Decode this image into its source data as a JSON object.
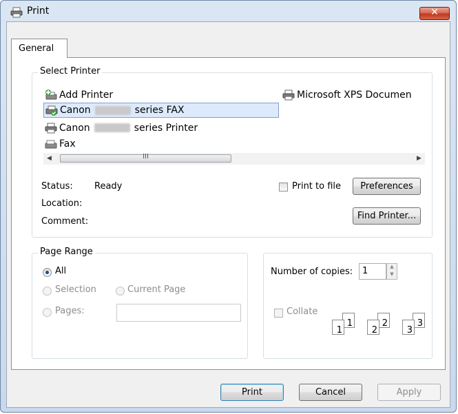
{
  "window": {
    "title": "Print"
  },
  "tabs": [
    {
      "label": "General"
    }
  ],
  "select_printer": {
    "group_label": "Select Printer",
    "printers": [
      {
        "name": "Add Printer",
        "icon": "add-printer-icon"
      },
      {
        "name_prefix": "Canon",
        "name_suffix": "series FAX",
        "icon": "fax-printer-icon",
        "selected": true
      },
      {
        "name_prefix": "Canon",
        "name_suffix": "series Printer",
        "icon": "printer-icon"
      },
      {
        "name": "Fax",
        "icon": "fax-icon"
      },
      {
        "name": "Microsoft XPS Documen",
        "icon": "printer-icon"
      }
    ],
    "status_label": "Status:",
    "status_value": "Ready",
    "location_label": "Location:",
    "comment_label": "Comment:",
    "print_to_file_label": "Print to file",
    "preferences_label": "Preferences",
    "find_printer_label": "Find Printer..."
  },
  "page_range": {
    "group_label": "Page Range",
    "all_label": "All",
    "selection_label": "Selection",
    "current_page_label": "Current Page",
    "pages_label": "Pages:",
    "pages_value": ""
  },
  "copies": {
    "number_label": "Number of copies:",
    "number_value": "1",
    "collate_label": "Collate",
    "collate_pages": [
      "1",
      "1",
      "2",
      "2",
      "3",
      "3"
    ]
  },
  "buttons": {
    "print": "Print",
    "cancel": "Cancel",
    "apply": "Apply"
  },
  "colors": {
    "selection_bg": "#dceafc",
    "close_button": "#c0391f",
    "titlebar": "#dbe6f3"
  }
}
